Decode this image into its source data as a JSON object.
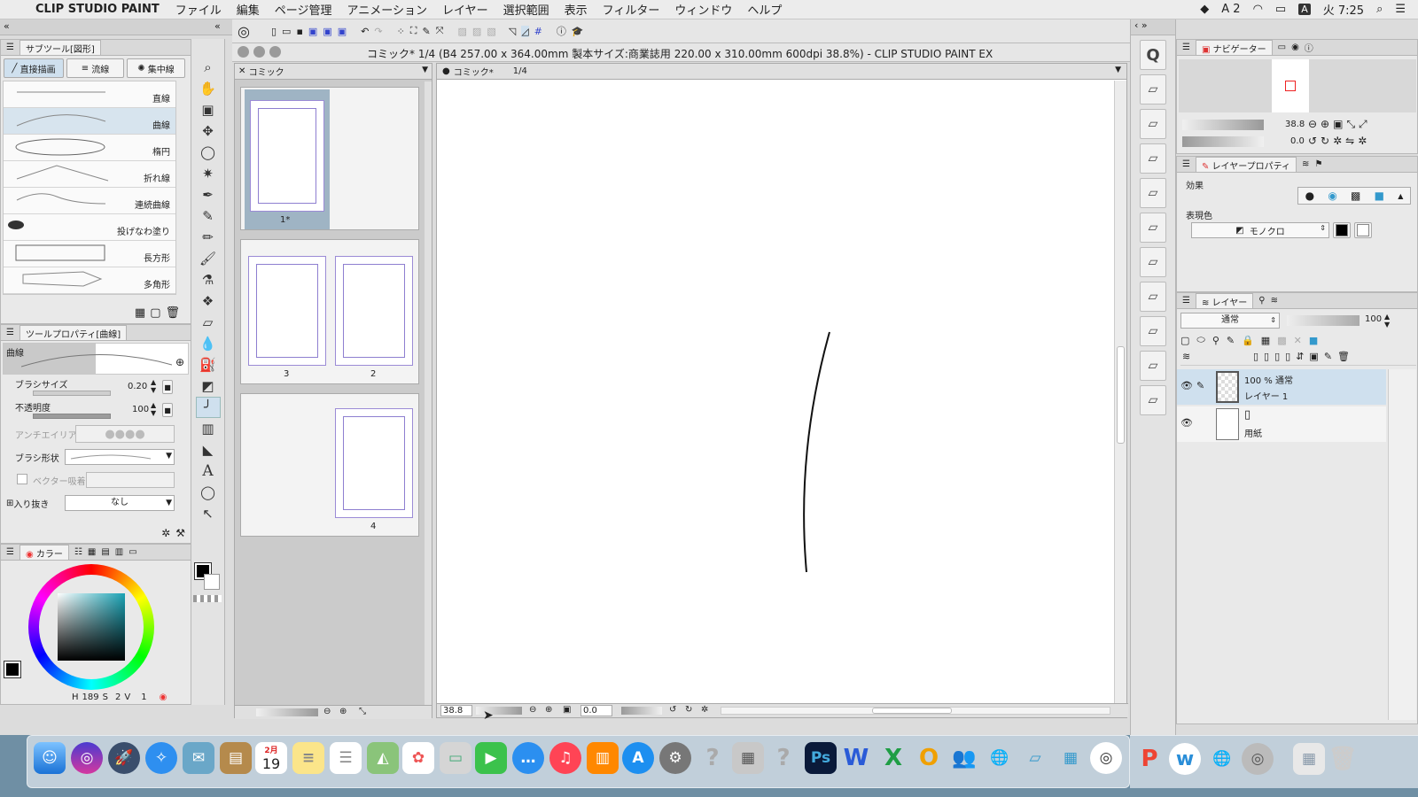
{
  "menubar": {
    "app": "CLIP STUDIO PAINT",
    "items": [
      "ファイル",
      "編集",
      "ページ管理",
      "アニメーション",
      "レイヤー",
      "選択範囲",
      "表示",
      "フィルター",
      "ウィンドウ",
      "ヘルプ"
    ],
    "status": {
      "adobe_count": "2",
      "input": "A",
      "clock": "火 7:25"
    }
  },
  "window": {
    "title": "コミック* 1/4 (B4 257.00 x 364.00mm 製本サイズ:商業誌用 220.00 x 310.00mm 600dpi 38.8%)  - CLIP STUDIO PAINT EX"
  },
  "subtool": {
    "header": "サブツール[図形]",
    "tabs": [
      "直接描画",
      "流線",
      "集中線"
    ],
    "items": [
      {
        "label": "直線"
      },
      {
        "label": "曲線"
      },
      {
        "label": "楕円"
      },
      {
        "label": "折れ線"
      },
      {
        "label": "連続曲線"
      },
      {
        "label": "投げなわ塗り"
      },
      {
        "label": "長方形"
      },
      {
        "label": "多角形"
      }
    ],
    "selected": "曲線"
  },
  "toolprop": {
    "header": "ツールプロパティ[曲線]",
    "preview_label": "曲線",
    "brush_size_label": "ブラシサイズ",
    "brush_size": "0.20",
    "opacity_label": "不透明度",
    "opacity": "100",
    "antialias_label": "アンチエイリアス",
    "brush_shape_label": "ブラシ形状",
    "vector_label": "ベクター吸着",
    "inout_label": "入り抜き",
    "inout_value": "なし"
  },
  "color": {
    "tab": "カラー",
    "h": "189",
    "s": "2",
    "v": "1",
    "main_color": "#000000",
    "sub_color": "#ffffff",
    "square_color": "#1aa3b5"
  },
  "pages_panel": {
    "tab": "コミック",
    "pages": [
      {
        "label": "1*"
      },
      {
        "label": "3"
      },
      {
        "label": "2"
      },
      {
        "label": "4"
      }
    ]
  },
  "canvas": {
    "tab": "コミック*",
    "page_indicator": "1/4",
    "zoom": "38.8",
    "rotation": "0.0"
  },
  "navigator": {
    "tab": "ナビゲーター",
    "zoom": "38.8",
    "rotation": "0.0"
  },
  "layer_property": {
    "tab": "レイヤープロパティ",
    "effect_label": "効果",
    "color_label": "表現色",
    "color_mode": "モノクロ"
  },
  "layers": {
    "tab": "レイヤー",
    "blend": "通常",
    "opacity": "100",
    "items": [
      {
        "blend": "100 % 通常",
        "name": "レイヤー 1"
      },
      {
        "blend": "",
        "name": "用紙"
      }
    ]
  },
  "dock": {
    "calendar_month": "2月",
    "calendar_day": "19"
  }
}
